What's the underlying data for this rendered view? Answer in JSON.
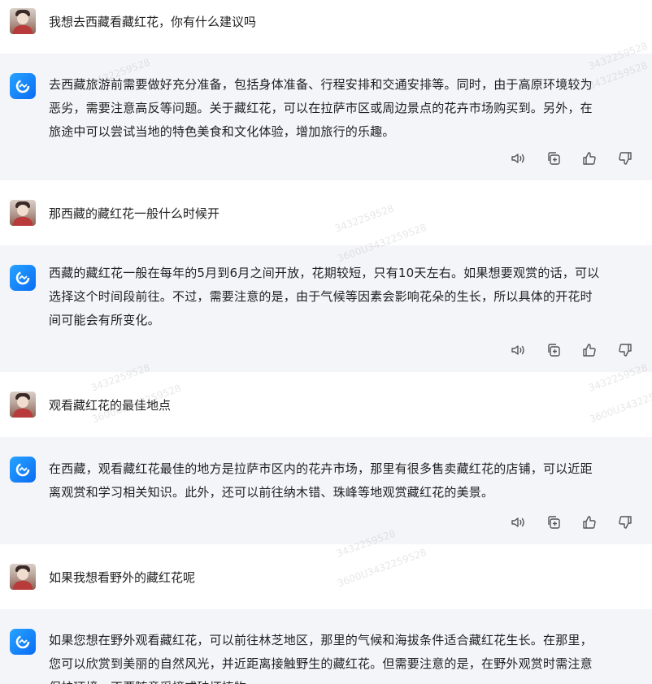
{
  "conversation": [
    {
      "role": "user",
      "text": "我想去西藏看藏红花，你有什么建议吗"
    },
    {
      "role": "assistant",
      "lines": [
        "去西藏旅游前需要做好充分准备，包括身体准备、行程安排和交通安排等。同时，由于高原环境较为",
        "恶劣，需要注意高反等问题。关于藏红花，可以在拉萨市区或周边景点的花卉市场购买到。另外，在",
        "旅途中可以尝试当地的特色美食和文化体验，增加旅行的乐趣。"
      ]
    },
    {
      "role": "user",
      "text": "那西藏的藏红花一般什么时候开"
    },
    {
      "role": "assistant",
      "lines": [
        "西藏的藏红花一般在每年的5月到6月之间开放，花期较短，只有10天左右。如果想要观赏的话，可以",
        "选择这个时间段前往。不过，需要注意的是，由于气候等因素会影响花朵的生长，所以具体的开花时",
        "间可能会有所变化。"
      ]
    },
    {
      "role": "user",
      "text": "观看藏红花的最佳地点"
    },
    {
      "role": "assistant",
      "lines": [
        "在西藏，观看藏红花最佳的地方是拉萨市区内的花卉市场，那里有很多售卖藏红花的店铺，可以近距",
        "离观赏和学习相关知识。此外，还可以前往纳木错、珠峰等地观赏藏红花的美景。"
      ]
    },
    {
      "role": "user",
      "text": "如果我想看野外的藏红花呢"
    },
    {
      "role": "assistant",
      "lines": [
        "如果您想在野外观看藏红花，可以前往林芝地区，那里的气候和海拔条件适合藏红花生长。在那里，",
        "您可以欣赏到美丽的自然风光，并近距离接触野生的藏红花。但需要注意的是，在野外观赏时需注意",
        "保护环境，不要随意采摘或破坏植物。"
      ]
    }
  ],
  "actions": {
    "icons": [
      "speaker-icon",
      "copy-icon",
      "thumbs-up-icon",
      "thumbs-down-icon"
    ]
  },
  "watermarks": [
    "3432259528",
    "3432259528",
    "3432259528",
    "3600U3432259528",
    "3432259528",
    "3432259528",
    "3600U3432259528",
    "3432259528",
    "3600U3432259528",
    "3432259528",
    "3600U3432259528"
  ],
  "colors": {
    "bot_bg": "#f4f5f9",
    "user_bg": "#ffffff",
    "bot_avatar": "#0a6cf5",
    "icon": "#555555"
  }
}
